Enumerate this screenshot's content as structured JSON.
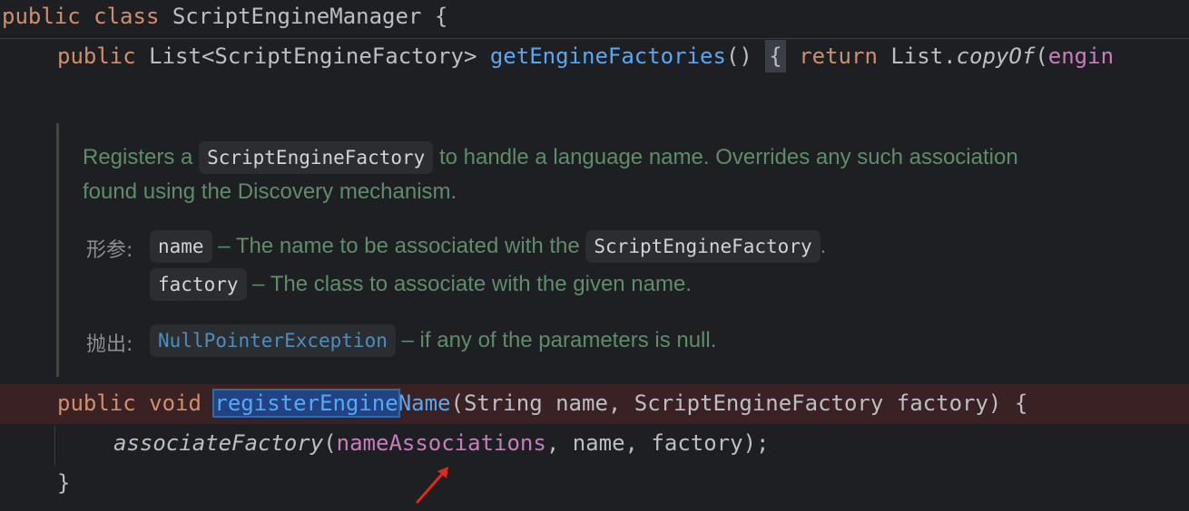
{
  "code": {
    "line1": {
      "kw1": "public",
      "kw2": "class",
      "name": "ScriptEngineManager",
      "brace": "{"
    },
    "line2": {
      "kw1": "public",
      "type": "List<ScriptEngineFactory>",
      "method": "getEngineFactories",
      "parens": "()",
      "brace": "{",
      "kw_return": "return",
      "list": "List.",
      "copy": "copyOf",
      "paren": "(",
      "field": "engin"
    },
    "line3": {
      "kw1": "public",
      "kw2": "void",
      "method_sel": "registerEngine",
      "method_rest": "Name",
      "params": "(String name, ScriptEngineFactory factory) {"
    },
    "line4": {
      "call": "associateFactory",
      "paren": "(",
      "field": "nameAssociations",
      "args": ", name, factory);"
    },
    "line5": {
      "brace": "}"
    }
  },
  "doc": {
    "sentence1_a": "Registers a ",
    "sentence1_chip": "ScriptEngineFactory",
    "sentence1_b": " to handle a language name. Overrides any such association",
    "sentence2": "found using the Discovery mechanism.",
    "params_tag": "形参:",
    "param1_chip": "name",
    "param1_text_a": " – The name to be associated with the ",
    "param1_text_chip": "ScriptEngineFactory",
    "param1_text_b": ".",
    "param2_chip": "factory",
    "param2_text": " – The class to associate with the given name.",
    "throws_tag": "抛出:",
    "throws_chip": "NullPointerException",
    "throws_text": " – if any of the parameters is null."
  },
  "colors": {
    "background": "#1e1f22",
    "keyword": "#cf8e6d",
    "method": "#56a8f5",
    "field": "#c77dbb",
    "doc_text": "#5f8c6a",
    "error_line": "#3a2224",
    "arrow": "#e0281e"
  },
  "icons": {
    "annotation": "red-arrow-icon"
  }
}
